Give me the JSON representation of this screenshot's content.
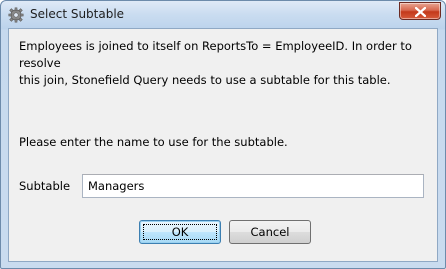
{
  "window": {
    "title": "Select Subtable",
    "icon": "gear-icon",
    "close_icon": "close-icon"
  },
  "dialog": {
    "message": "Employees is joined to itself on ReportsTo = EmployeeID. In order to resolve\nthis join, Stonefield Query needs to use a subtable for this table.",
    "prompt": "Please enter the name to use for the subtable.",
    "field_label": "Subtable",
    "field_value": "Managers"
  },
  "buttons": {
    "ok": "OK",
    "cancel": "Cancel"
  },
  "colors": {
    "close_button": "#c3391b",
    "default_button_border": "#3c7fb1"
  }
}
